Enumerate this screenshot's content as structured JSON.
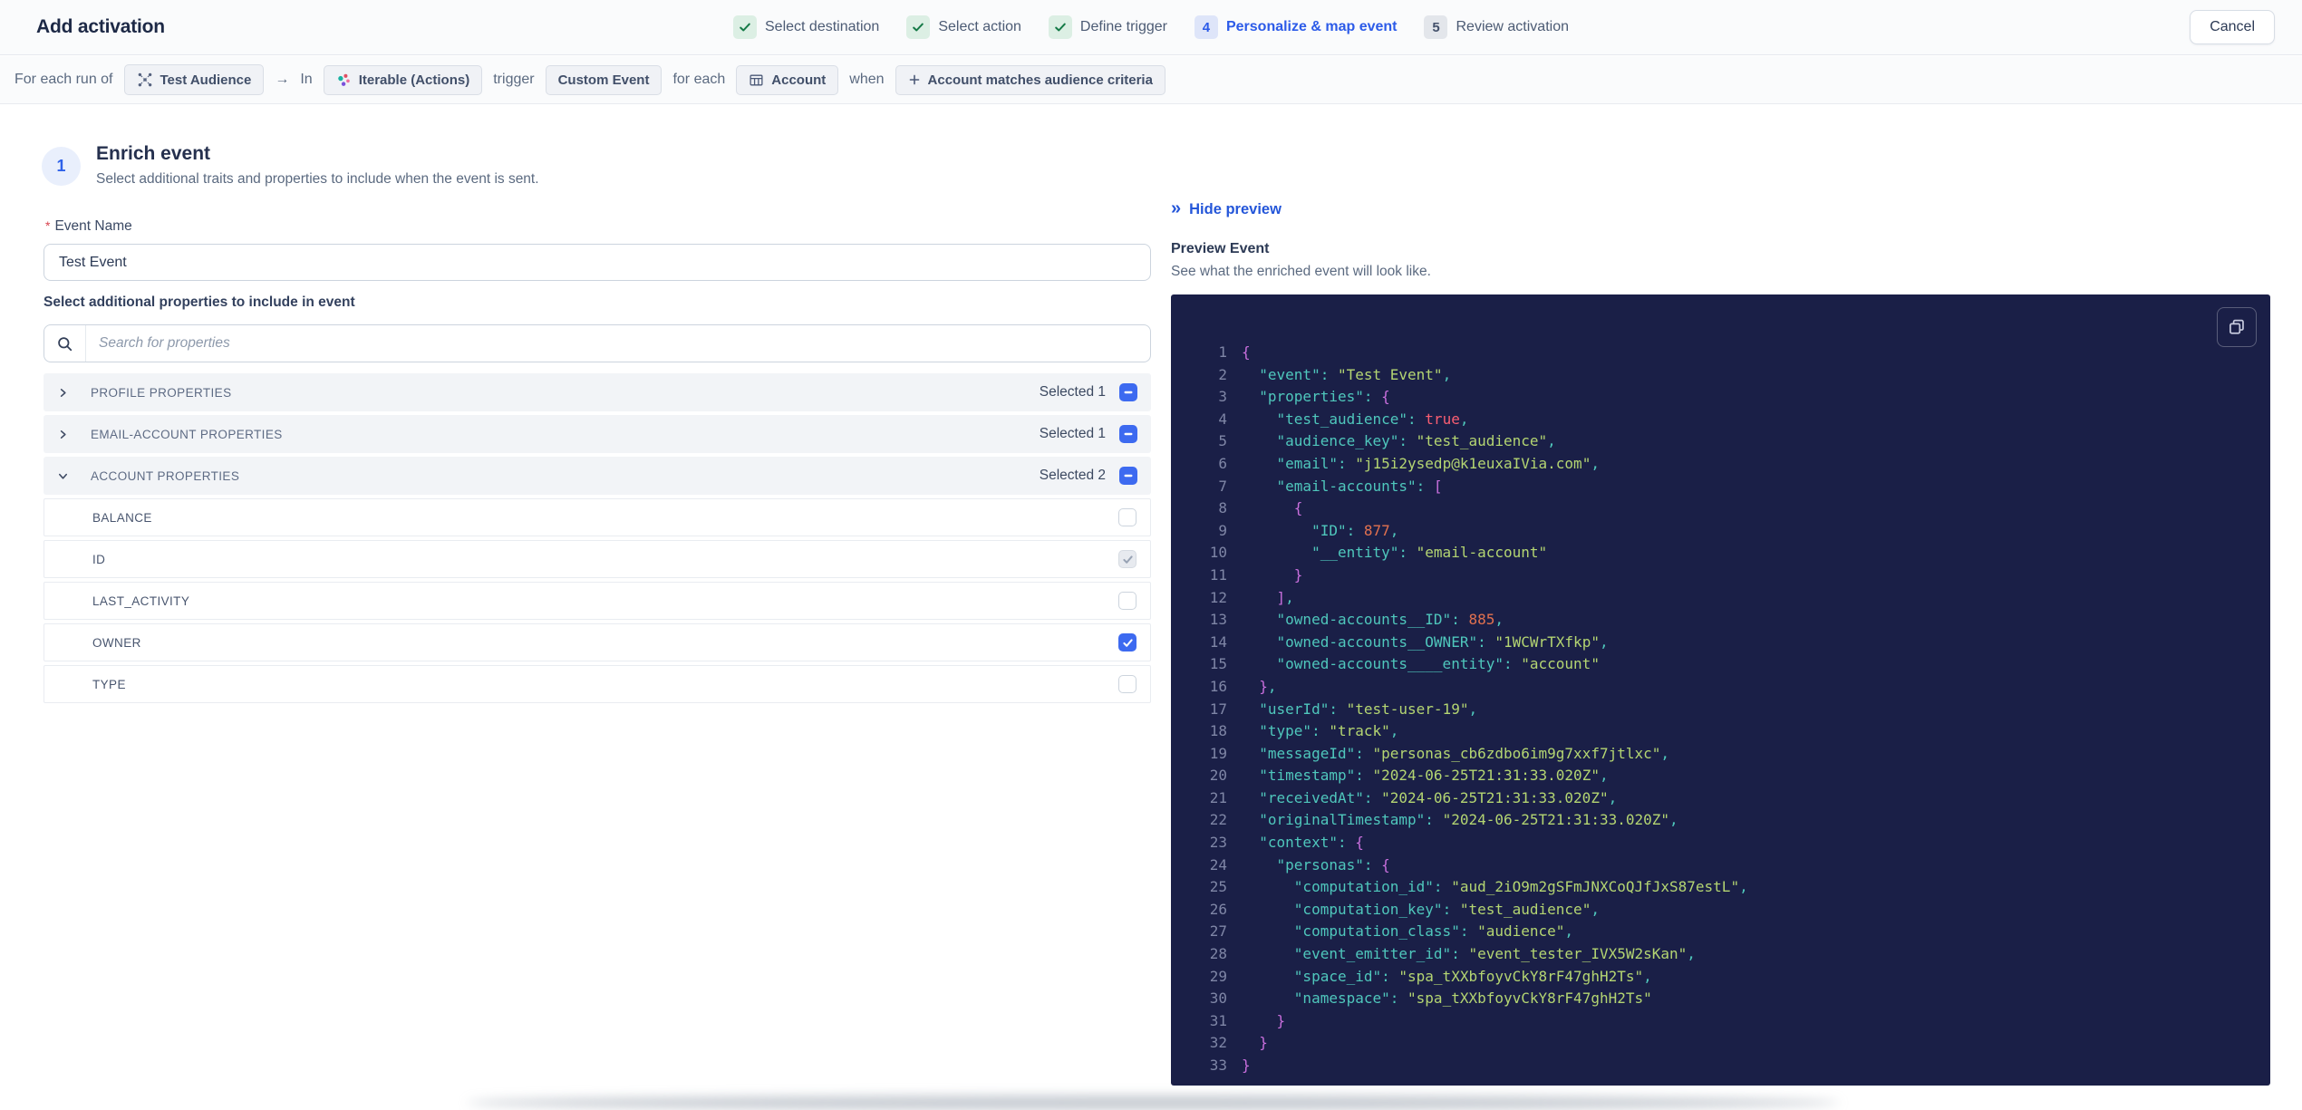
{
  "header": {
    "title": "Add activation",
    "cancel_label": "Cancel",
    "steps": [
      {
        "label": "Select destination",
        "state": "done"
      },
      {
        "label": "Select action",
        "state": "done"
      },
      {
        "label": "Define trigger",
        "state": "done"
      },
      {
        "label": "Personalize & map event",
        "state": "active",
        "number": "4"
      },
      {
        "label": "Review activation",
        "state": "upcoming",
        "number": "5"
      }
    ]
  },
  "trigger_bar": {
    "segments": [
      {
        "type": "text",
        "text": "For each run of"
      },
      {
        "type": "chip",
        "icon": "audience-icon",
        "text": "Test Audience"
      },
      {
        "type": "text",
        "text": "→"
      },
      {
        "type": "text",
        "text": "In"
      },
      {
        "type": "chip",
        "icon": "iterable-icon",
        "text": "Iterable (Actions)"
      },
      {
        "type": "text",
        "text": "trigger"
      },
      {
        "type": "chip",
        "text": "Custom Event"
      },
      {
        "type": "text",
        "text": "for each"
      },
      {
        "type": "chip",
        "icon": "table-icon",
        "text": "Account"
      },
      {
        "type": "text",
        "text": "when"
      },
      {
        "type": "chip",
        "icon": "plus-icon",
        "text": "Account matches audience criteria"
      }
    ]
  },
  "enrich": {
    "step_number": "1",
    "title": "Enrich event",
    "subtitle": "Select additional traits and properties to include when the event is sent.",
    "event_name": {
      "label": "Event Name",
      "required": "*",
      "value": "Test Event"
    },
    "properties_label": "Select additional properties to include in event",
    "search": {
      "placeholder": "Search for properties"
    },
    "groups": [
      {
        "label": "PROFILE PROPERTIES",
        "selected_label": "Selected 1",
        "expanded": false,
        "items": []
      },
      {
        "label": "EMAIL-ACCOUNT PROPERTIES",
        "selected_label": "Selected 1",
        "expanded": false,
        "items": []
      },
      {
        "label": "ACCOUNT PROPERTIES",
        "selected_label": "Selected 2",
        "expanded": true,
        "items": [
          {
            "label": "BALANCE",
            "state": "unchecked"
          },
          {
            "label": "ID",
            "state": "checked-disabled"
          },
          {
            "label": "LAST_ACTIVITY",
            "state": "unchecked"
          },
          {
            "label": "OWNER",
            "state": "checked"
          },
          {
            "label": "TYPE",
            "state": "unchecked"
          }
        ]
      }
    ]
  },
  "preview": {
    "hide_label": "Hide preview",
    "title": "Preview Event",
    "subtitle": "See what the enriched event will look like.",
    "code": {
      "lines": [
        [
          [
            "p",
            "{"
          ]
        ],
        [
          [
            "w",
            "  "
          ],
          [
            "k",
            "\"event\""
          ],
          [
            "d",
            ": "
          ],
          [
            "s",
            "\"Test Event\""
          ],
          [
            "d",
            ","
          ]
        ],
        [
          [
            "w",
            "  "
          ],
          [
            "k",
            "\"properties\""
          ],
          [
            "d",
            ": "
          ],
          [
            "p",
            "{"
          ]
        ],
        [
          [
            "w",
            "    "
          ],
          [
            "k",
            "\"test_audience\""
          ],
          [
            "d",
            ": "
          ],
          [
            "b",
            "true"
          ],
          [
            "d",
            ","
          ]
        ],
        [
          [
            "w",
            "    "
          ],
          [
            "k",
            "\"audience_key\""
          ],
          [
            "d",
            ": "
          ],
          [
            "s",
            "\"test_audience\""
          ],
          [
            "d",
            ","
          ]
        ],
        [
          [
            "w",
            "    "
          ],
          [
            "k",
            "\"email\""
          ],
          [
            "d",
            ": "
          ],
          [
            "s",
            "\"j15i2ysedp@k1euxaIVia.com\""
          ],
          [
            "d",
            ","
          ]
        ],
        [
          [
            "w",
            "    "
          ],
          [
            "k",
            "\"email-accounts\""
          ],
          [
            "d",
            ": "
          ],
          [
            "p",
            "["
          ]
        ],
        [
          [
            "w",
            "      "
          ],
          [
            "p",
            "{"
          ]
        ],
        [
          [
            "w",
            "        "
          ],
          [
            "k",
            "\"ID\""
          ],
          [
            "d",
            ": "
          ],
          [
            "n",
            "877"
          ],
          [
            "d",
            ","
          ]
        ],
        [
          [
            "w",
            "        "
          ],
          [
            "k",
            "\"__entity\""
          ],
          [
            "d",
            ": "
          ],
          [
            "s",
            "\"email-account\""
          ]
        ],
        [
          [
            "w",
            "      "
          ],
          [
            "p",
            "}"
          ]
        ],
        [
          [
            "w",
            "    "
          ],
          [
            "p",
            "]"
          ],
          [
            "d",
            ","
          ]
        ],
        [
          [
            "w",
            "    "
          ],
          [
            "k",
            "\"owned-accounts__ID\""
          ],
          [
            "d",
            ": "
          ],
          [
            "n",
            "885"
          ],
          [
            "d",
            ","
          ]
        ],
        [
          [
            "w",
            "    "
          ],
          [
            "k",
            "\"owned-accounts__OWNER\""
          ],
          [
            "d",
            ": "
          ],
          [
            "s",
            "\"1WCWrTXfkp\""
          ],
          [
            "d",
            ","
          ]
        ],
        [
          [
            "w",
            "    "
          ],
          [
            "k",
            "\"owned-accounts____entity\""
          ],
          [
            "d",
            ": "
          ],
          [
            "s",
            "\"account\""
          ]
        ],
        [
          [
            "w",
            "  "
          ],
          [
            "p",
            "}"
          ],
          [
            "d",
            ","
          ]
        ],
        [
          [
            "w",
            "  "
          ],
          [
            "k",
            "\"userId\""
          ],
          [
            "d",
            ": "
          ],
          [
            "s",
            "\"test-user-19\""
          ],
          [
            "d",
            ","
          ]
        ],
        [
          [
            "w",
            "  "
          ],
          [
            "k",
            "\"type\""
          ],
          [
            "d",
            ": "
          ],
          [
            "s",
            "\"track\""
          ],
          [
            "d",
            ","
          ]
        ],
        [
          [
            "w",
            "  "
          ],
          [
            "k",
            "\"messageId\""
          ],
          [
            "d",
            ": "
          ],
          [
            "s",
            "\"personas_cb6zdbo6im9g7xxf7jtlxc\""
          ],
          [
            "d",
            ","
          ]
        ],
        [
          [
            "w",
            "  "
          ],
          [
            "k",
            "\"timestamp\""
          ],
          [
            "d",
            ": "
          ],
          [
            "s",
            "\"2024-06-25T21:31:33.020Z\""
          ],
          [
            "d",
            ","
          ]
        ],
        [
          [
            "w",
            "  "
          ],
          [
            "k",
            "\"receivedAt\""
          ],
          [
            "d",
            ": "
          ],
          [
            "s",
            "\"2024-06-25T21:31:33.020Z\""
          ],
          [
            "d",
            ","
          ]
        ],
        [
          [
            "w",
            "  "
          ],
          [
            "k",
            "\"originalTimestamp\""
          ],
          [
            "d",
            ": "
          ],
          [
            "s",
            "\"2024-06-25T21:31:33.020Z\""
          ],
          [
            "d",
            ","
          ]
        ],
        [
          [
            "w",
            "  "
          ],
          [
            "k",
            "\"context\""
          ],
          [
            "d",
            ": "
          ],
          [
            "p",
            "{"
          ]
        ],
        [
          [
            "w",
            "    "
          ],
          [
            "k",
            "\"personas\""
          ],
          [
            "d",
            ": "
          ],
          [
            "p",
            "{"
          ]
        ],
        [
          [
            "w",
            "      "
          ],
          [
            "k",
            "\"computation_id\""
          ],
          [
            "d",
            ": "
          ],
          [
            "s",
            "\"aud_2iO9m2gSFmJNXCoQJfJxS87estL\""
          ],
          [
            "d",
            ","
          ]
        ],
        [
          [
            "w",
            "      "
          ],
          [
            "k",
            "\"computation_key\""
          ],
          [
            "d",
            ": "
          ],
          [
            "s",
            "\"test_audience\""
          ],
          [
            "d",
            ","
          ]
        ],
        [
          [
            "w",
            "      "
          ],
          [
            "k",
            "\"computation_class\""
          ],
          [
            "d",
            ": "
          ],
          [
            "s",
            "\"audience\""
          ],
          [
            "d",
            ","
          ]
        ],
        [
          [
            "w",
            "      "
          ],
          [
            "k",
            "\"event_emitter_id\""
          ],
          [
            "d",
            ": "
          ],
          [
            "s",
            "\"event_tester_IVX5W2sKan\""
          ],
          [
            "d",
            ","
          ]
        ],
        [
          [
            "w",
            "      "
          ],
          [
            "k",
            "\"space_id\""
          ],
          [
            "d",
            ": "
          ],
          [
            "s",
            "\"spa_tXXbfoyvCkY8rF47ghH2Ts\""
          ],
          [
            "d",
            ","
          ]
        ],
        [
          [
            "w",
            "      "
          ],
          [
            "k",
            "\"namespace\""
          ],
          [
            "d",
            ": "
          ],
          [
            "s",
            "\"spa_tXXbfoyvCkY8rF47ghH2Ts\""
          ]
        ],
        [
          [
            "w",
            "    "
          ],
          [
            "p",
            "}"
          ]
        ],
        [
          [
            "w",
            "  "
          ],
          [
            "p",
            "}"
          ]
        ],
        [
          [
            "p",
            "}"
          ]
        ]
      ]
    }
  },
  "colors": {
    "accent_blue": "#2c5be8",
    "checkbox_blue": "#3d6af0",
    "success_green": "#157a47",
    "code_background": "#1a1f47",
    "code_key": "#4fc7bc",
    "code_string": "#b4d572",
    "code_number": "#e2714f",
    "code_boolean": "#fa5e72",
    "code_punctuation": "#c96fdd"
  }
}
